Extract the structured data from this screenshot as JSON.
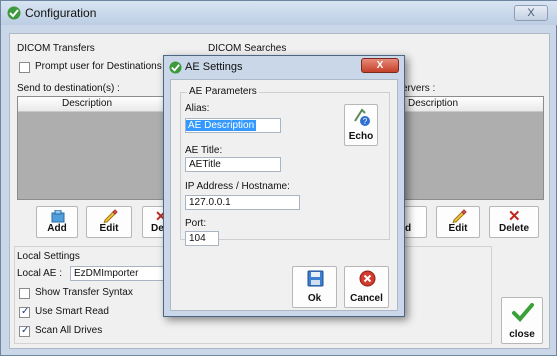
{
  "window": {
    "title": "Configuration",
    "close_label": "X"
  },
  "dicom_transfers": {
    "heading": "DICOM Transfers",
    "prompt_checkbox": {
      "label": "Prompt user for Destinations",
      "checked": false
    },
    "send_to_label": "Send to destination(s) :",
    "column": "Description",
    "buttons": {
      "add": "Add",
      "edit": "Edit",
      "delete_partial": "Del"
    }
  },
  "dicom_searches": {
    "heading": "DICOM Searches",
    "servers_label": "ervers :",
    "column": "Description",
    "buttons": {
      "add_partial": "d",
      "edit": "Edit",
      "delete": "Delete"
    }
  },
  "local_settings": {
    "heading": "Local Settings",
    "local_ae_label": "Local AE :",
    "local_ae_value": "EzDMImporter",
    "checkboxes": [
      {
        "label": "Show Transfer Syntax",
        "checked": false
      },
      {
        "label": "Use Smart Read",
        "checked": true
      },
      {
        "label": "Scan All Drives",
        "checked": true
      }
    ]
  },
  "close_button": "close",
  "ae_dialog": {
    "title": "AE Settings",
    "close_label": "X",
    "group": "AE Parameters",
    "alias_label": "Alias:",
    "alias_value": "AE Description",
    "echo_button": "Echo",
    "ae_title_label": "AE Title:",
    "ae_title_value": "AETitle",
    "ip_label": "IP Address / Hostname:",
    "ip_value": "127.0.0.1",
    "port_label": "Port:",
    "port_value": "104",
    "ok_button": "Ok",
    "cancel_button": "Cancel"
  },
  "colors": {
    "delete_red": "#c0271f",
    "accent_green": "#3aa03a",
    "selection_blue": "#3399ff"
  }
}
